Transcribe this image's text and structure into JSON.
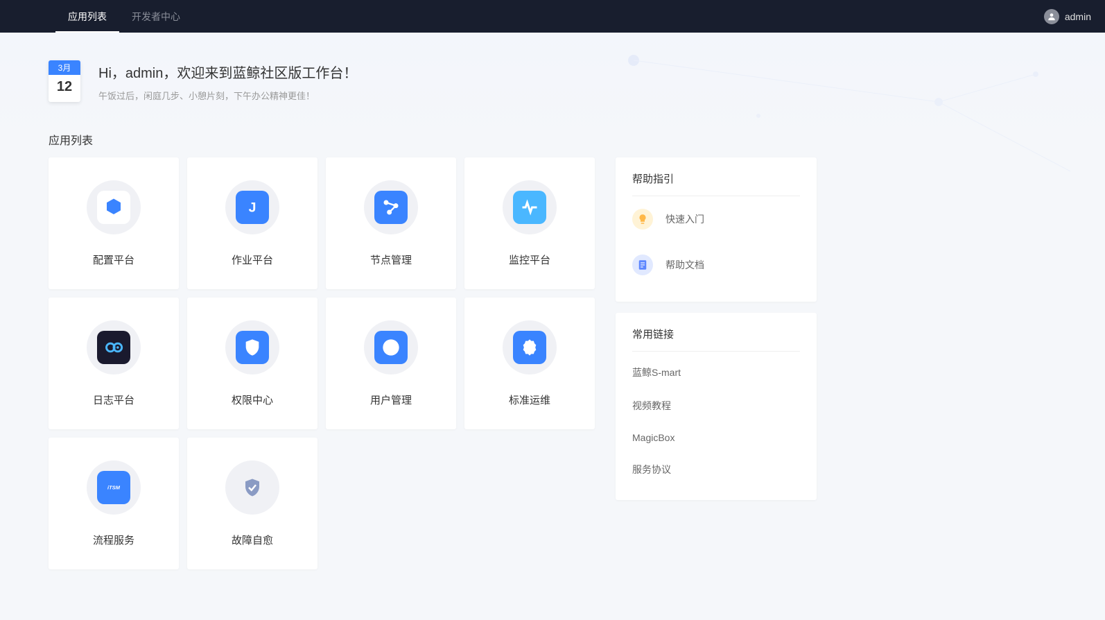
{
  "topbar": {
    "tabs": [
      {
        "label": "应用列表",
        "active": true
      },
      {
        "label": "开发者中心",
        "active": false
      }
    ],
    "username": "admin"
  },
  "date": {
    "month": "3月",
    "day": "12"
  },
  "welcome": {
    "title": "Hi，admin，欢迎来到蓝鲸社区版工作台！",
    "subtitle": "午饭过后，闲庭几步、小憩片刻，下午办公精神更佳！"
  },
  "section_title": "应用列表",
  "apps": [
    {
      "name": "配置平台",
      "icon": "hexagon",
      "bg": "#ffffff",
      "fg": "#3a84ff"
    },
    {
      "name": "作业平台",
      "icon": "letter-j",
      "bg": "#3a84ff",
      "fg": "#ffffff"
    },
    {
      "name": "节点管理",
      "icon": "nodes",
      "bg": "#3a84ff",
      "fg": "#ffffff"
    },
    {
      "name": "监控平台",
      "icon": "pulse",
      "bg": "#4ab7ff",
      "fg": "#ffffff"
    },
    {
      "name": "日志平台",
      "icon": "search-loop",
      "bg": "#1a1a2e",
      "fg": "#4ab7ff"
    },
    {
      "name": "权限中心",
      "icon": "shield",
      "bg": "#3a84ff",
      "fg": "#ffffff"
    },
    {
      "name": "用户管理",
      "icon": "user-circle",
      "bg": "#3a84ff",
      "fg": "#ffffff"
    },
    {
      "name": "标准运维",
      "icon": "gear",
      "bg": "#3a84ff",
      "fg": "#ffffff"
    },
    {
      "name": "流程服务",
      "icon": "itsm",
      "bg": "#3a84ff",
      "fg": "#ffffff"
    },
    {
      "name": "故障自愈",
      "icon": "shield-check",
      "bg": "#f0f1f5",
      "fg": "#8a9bc4"
    }
  ],
  "help_guide": {
    "title": "帮助指引",
    "items": [
      {
        "label": "快速入门",
        "icon": "bulb",
        "bg": "#fff3d6",
        "fg": "#ffb848"
      },
      {
        "label": "帮助文档",
        "icon": "doc",
        "bg": "#e1e9ff",
        "fg": "#5d87ff"
      }
    ]
  },
  "common_links": {
    "title": "常用链接",
    "items": [
      {
        "label": "蓝鲸S-mart"
      },
      {
        "label": "视频教程"
      },
      {
        "label": "MagicBox"
      },
      {
        "label": "服务协议"
      }
    ]
  }
}
